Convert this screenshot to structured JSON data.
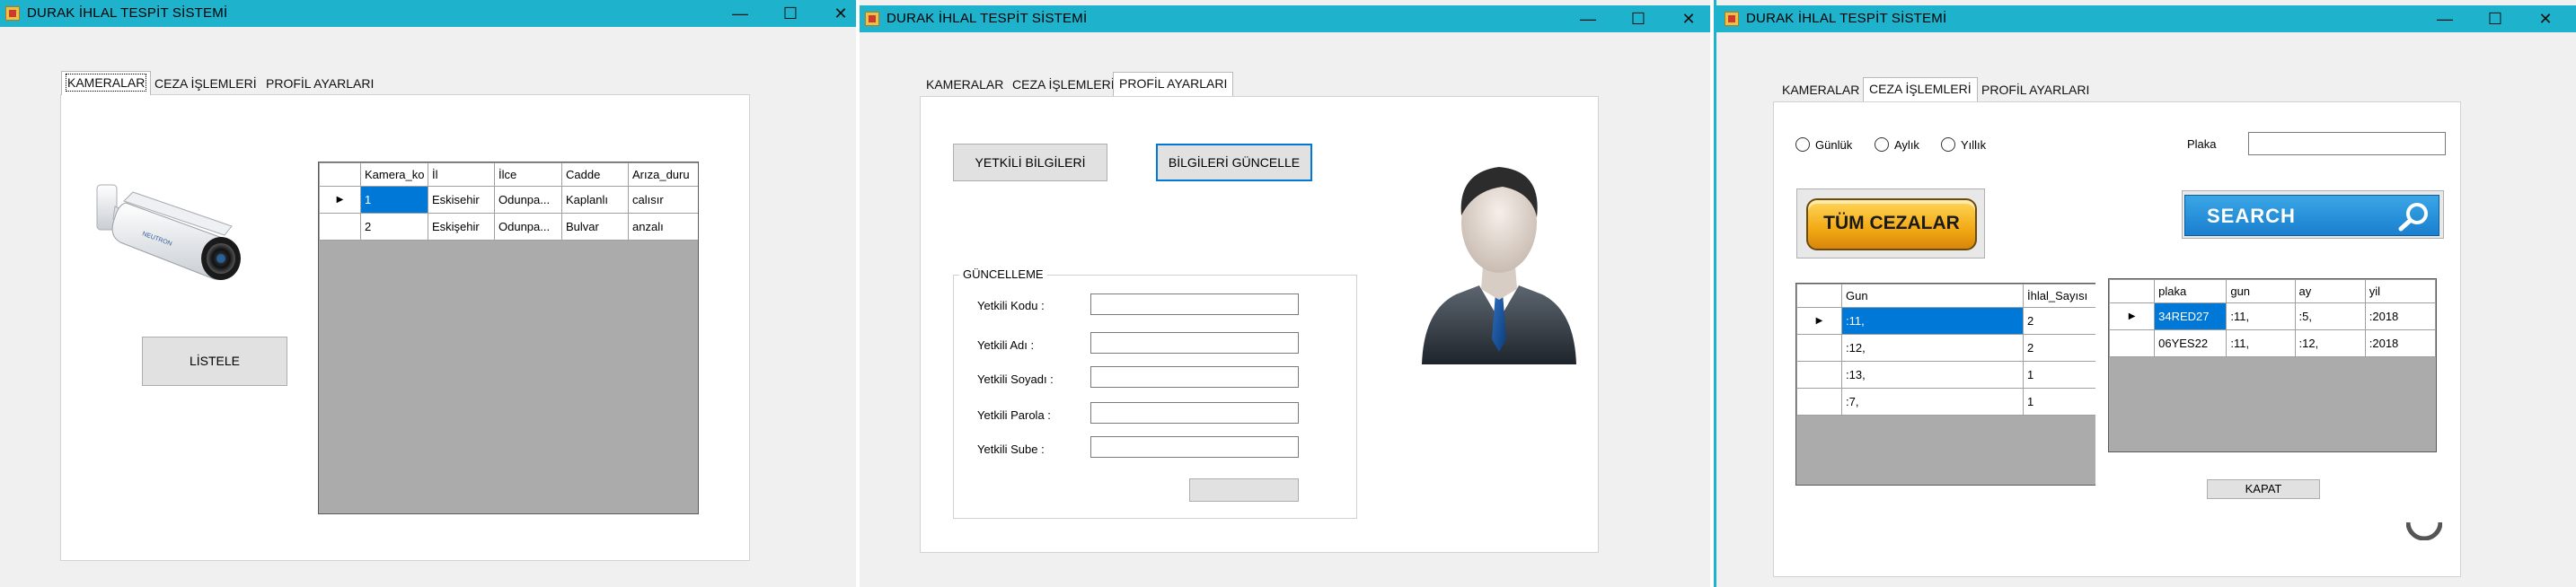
{
  "windows": [
    {
      "title": "DURAK İHLAL TESPİT SİSTEMİ",
      "controls": {
        "minimize": "—",
        "maximize": "☐",
        "close": "✕"
      },
      "tabs": [
        "KAMERALAR",
        "CEZA İŞLEMLERİ",
        "PROFİL AYARLARI"
      ],
      "active_tab": "KAMERALAR",
      "camera_brand": "NEUTRON",
      "grid": {
        "columns": [
          "Kamera_ko",
          "İl",
          "İlce",
          "Cadde",
          "Arıza_duru"
        ],
        "rows": [
          [
            "1",
            "Eskisehir",
            "Odunpa...",
            "Kaplanlı",
            "calısır"
          ],
          [
            "2",
            "Eskişehir",
            "Odunpa...",
            "Bulvar",
            "anzalı"
          ]
        ]
      },
      "list_button": "LİSTELE"
    },
    {
      "title": "DURAK İHLAL TESPİT SİSTEMİ",
      "controls": {
        "minimize": "—",
        "maximize": "☐",
        "close": "✕"
      },
      "tabs": [
        "KAMERALAR",
        "CEZA İŞLEMLERİ",
        "PROFİL AYARLARI"
      ],
      "active_tab": "PROFİL AYARLARI",
      "btn_officials": "YETKİLİ BİLGİLERİ",
      "btn_update": "BİLGİLERİ GÜNCELLE",
      "group_title": "GÜNCELLEME",
      "fields": [
        "Yetkili Kodu :",
        "Yetkili Adı :",
        "Yetkili Soyadı :",
        "Yetkili Parola :",
        "Yetkili Sube :"
      ],
      "submit_label": ""
    },
    {
      "title": "DURAK İHLAL TESPİT SİSTEMİ",
      "controls": {
        "minimize": "—",
        "maximize": "☐",
        "close": "✕"
      },
      "tabs": [
        "KAMERALAR",
        "CEZA İŞLEMLERİ",
        "PROFİL AYARLARI"
      ],
      "active_tab": "CEZA İŞLEMLERİ",
      "radios": [
        "Günlük",
        "Aylık",
        "Yıllık"
      ],
      "plate_label": "Plaka",
      "plate_value": "",
      "all_fines": "TÜM CEZALAR",
      "search": "SEARCH",
      "grid_left": {
        "columns": [
          "Gun",
          "İhlal_Sayısı"
        ],
        "rows": [
          [
            ":11,",
            "2"
          ],
          [
            ":12,",
            "2"
          ],
          [
            ":13,",
            "1"
          ],
          [
            ":7,",
            "1"
          ]
        ]
      },
      "grid_right": {
        "columns": [
          "plaka",
          "gun",
          "ay",
          "yil"
        ],
        "rows": [
          [
            "34RED27",
            ":11,",
            ":5,",
            ":2018"
          ],
          [
            "06YES22",
            ":11,",
            ":12,",
            ":2018"
          ]
        ]
      },
      "close_button": "KAPAT"
    }
  ],
  "colors": {
    "titlebar": "#1fb2cc",
    "selection": "#0078d7",
    "search_bg": "#1f8fd6",
    "fines_btn": "#f2b51b"
  }
}
